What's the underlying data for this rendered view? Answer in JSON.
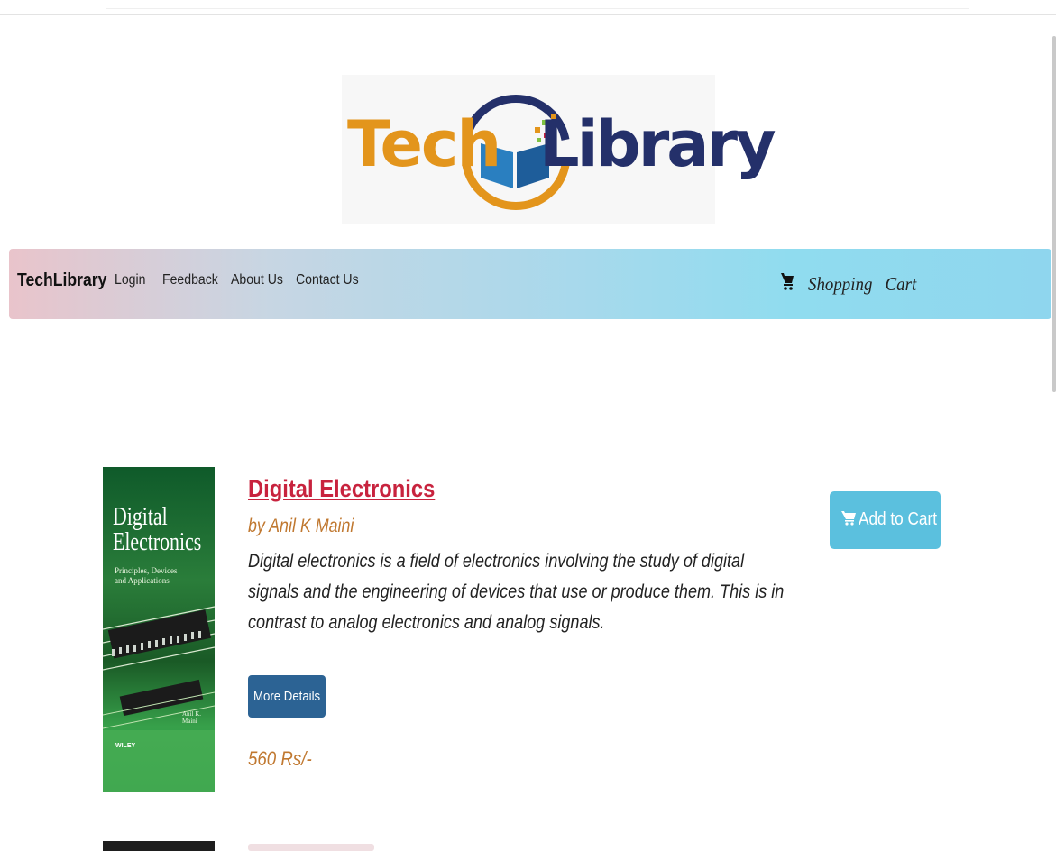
{
  "logo": {
    "word_left": "Tech",
    "word_right": "Library"
  },
  "navbar": {
    "brand": "TechLibrary",
    "links": [
      "Login",
      "Feedback",
      "About Us",
      "Contact Us"
    ],
    "cart": {
      "icon": "cart-icon",
      "label": "Shopping   Cart"
    }
  },
  "product": {
    "cover": {
      "title_line1": "Digital",
      "title_line2": "Electronics",
      "subtitle": "Principles, Devices and Applications",
      "author": "Anil K. Maini",
      "publisher": "WILEY"
    },
    "title": "Digital Electronics",
    "author": "by Anil K Maini",
    "description": "Digital electronics is a field of electronics involving the study of digital signals and the engineering of devices that use or produce them. This is in contrast to analog electronics and analog signals.",
    "details_label": "More Details",
    "price": "560 Rs/-",
    "add_to_cart_label": "Add to Cart"
  },
  "colors": {
    "title_link": "#c8233e",
    "accent_text": "#c07830",
    "primary_button": "#2c6394",
    "info_button": "#5bc0de"
  }
}
